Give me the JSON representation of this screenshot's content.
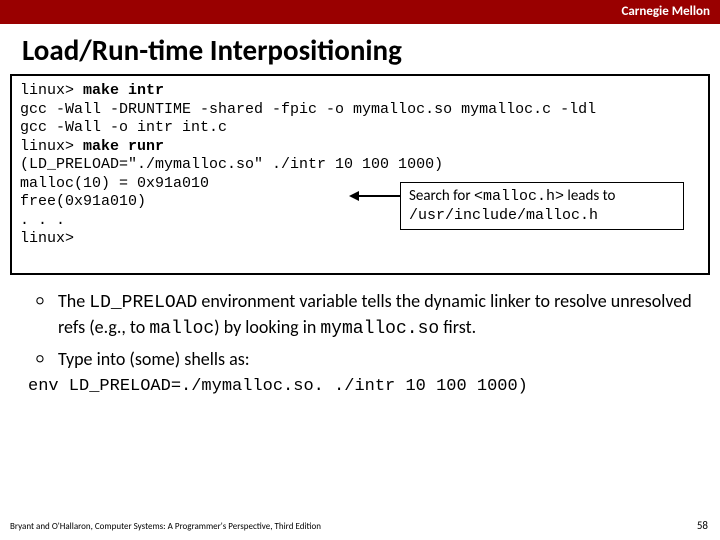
{
  "header": {
    "brand": "Carnegie Mellon"
  },
  "title": "Load/Run-time Interpositioning",
  "code": {
    "l1a": "linux> ",
    "l1b": "make intr",
    "l2": "gcc -Wall -DRUNTIME -shared -fpic -o mymalloc.so mymalloc.c -ldl",
    "l3": "gcc -Wall -o intr int.c",
    "l4a": "linux> ",
    "l4b": "make runr",
    "l5": "(LD_PRELOAD=\"./mymalloc.so\" ./intr 10 100 1000)",
    "l6": "malloc(10) = 0x91a010",
    "l7": "free(0x91a010)",
    "l8": ". . .",
    "l9": "linux>"
  },
  "callout": {
    "pre": "Search for ",
    "mono1": "<malloc.h>",
    "mid": " leads to ",
    "mono2": "/usr/include/malloc.h"
  },
  "bullets": {
    "b1_pre": "The ",
    "b1_code1": "LD_PRELOAD",
    "b1_mid": " environment variable tells the dynamic linker to resolve unresolved refs (e.g., to ",
    "b1_code2": "malloc",
    "b1_post": ") by looking in ",
    "b1_code3": "mymalloc.so",
    "b1_end": " first.",
    "b2": "Type into (some) shells as:"
  },
  "envline": "env LD_PRELOAD=./mymalloc.so. ./intr 10 100 1000)",
  "footer": "Bryant and O'Hallaron, Computer Systems: A Programmer's Perspective, Third Edition",
  "page": "58"
}
